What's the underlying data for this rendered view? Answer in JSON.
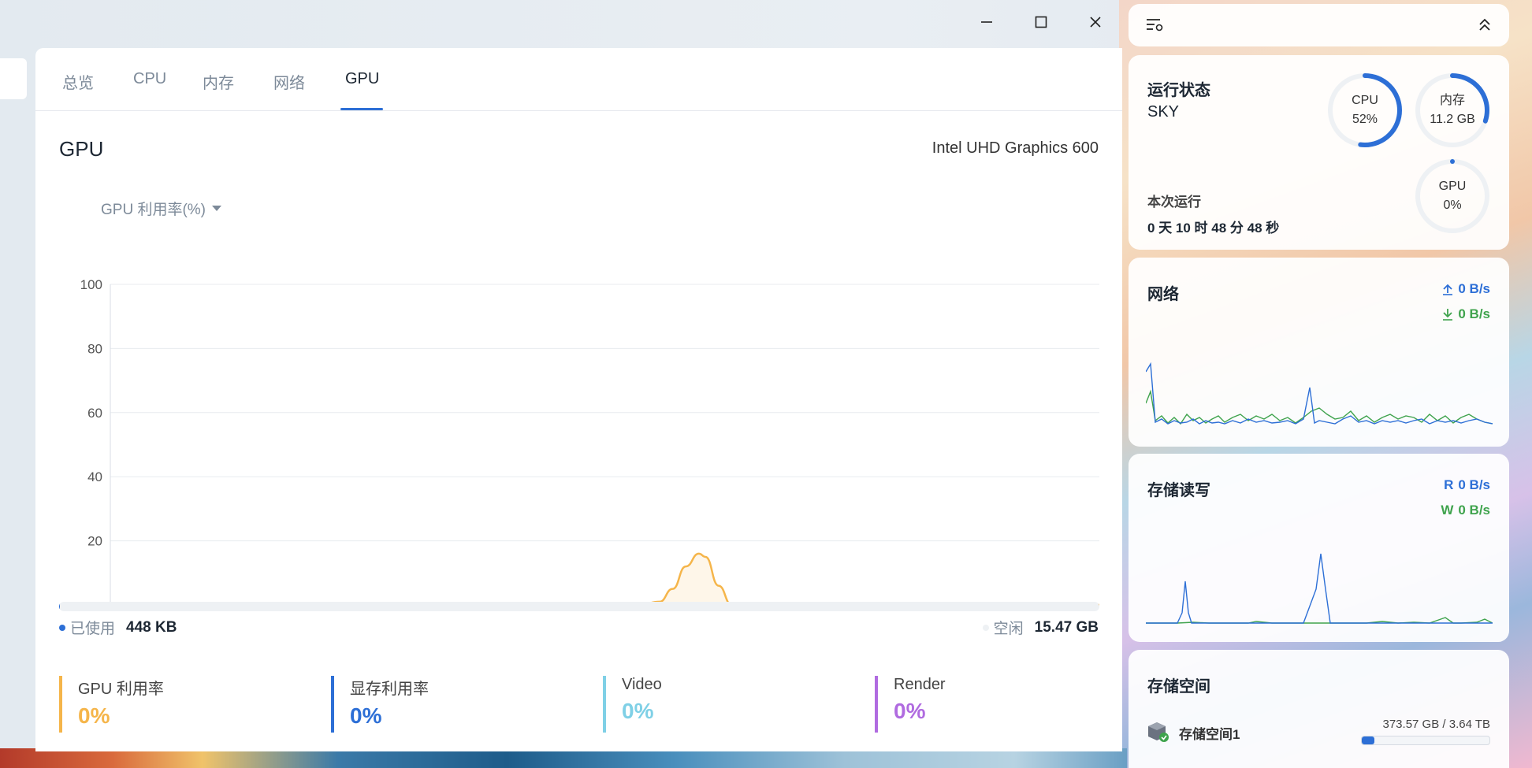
{
  "window": {
    "controls": [
      "minimize",
      "maximize",
      "close"
    ]
  },
  "tabs": [
    {
      "label": "总览",
      "active": false
    },
    {
      "label": "CPU",
      "active": false
    },
    {
      "label": "内存",
      "active": false
    },
    {
      "label": "网络",
      "active": false
    },
    {
      "label": "GPU",
      "active": true
    }
  ],
  "gpu": {
    "title": "GPU",
    "model": "Intel UHD Graphics 600",
    "metric_selector": "GPU 利用率(%)"
  },
  "chart_data": {
    "type": "area",
    "title": "",
    "xlabel": "",
    "ylabel": "",
    "ylim": [
      0,
      100
    ],
    "yticks": [
      "100",
      "80",
      "60",
      "40",
      "20"
    ],
    "grid": true,
    "series": [
      {
        "color": "#f5b54a",
        "x": [
          0,
          5,
          10,
          15,
          20,
          25,
          30,
          33,
          35,
          37,
          39,
          40,
          42,
          44,
          47,
          50,
          55,
          60,
          65,
          70,
          75,
          80,
          85,
          90,
          95,
          100
        ],
        "values": [
          0,
          0,
          0,
          0,
          0,
          0,
          0,
          1,
          5,
          12,
          16,
          15,
          6,
          0,
          0,
          0,
          0,
          0,
          0,
          0,
          0,
          0,
          0,
          0,
          0,
          0
        ]
      }
    ]
  },
  "memory": {
    "used_label": "已使用",
    "used_value": "448 KB",
    "free_label": "空闲",
    "free_value": "15.47 GB",
    "used_fraction": 0.0003
  },
  "stats": [
    {
      "label": "GPU 利用率",
      "value": "0%",
      "color": "#f5b54a"
    },
    {
      "label": "显存利用率",
      "value": "0%",
      "color": "#2d6fd6"
    },
    {
      "label": "Video",
      "value": "0%",
      "color": "#7fd0e6"
    },
    {
      "label": "Render",
      "value": "0%",
      "color": "#b06be0"
    }
  ],
  "status": {
    "title": "运行状态",
    "host": "SKY",
    "uptime_label": "本次运行",
    "uptime_value": "0 天 10 时 48 分 48 秒",
    "rings": [
      {
        "label": "CPU",
        "value": "52%",
        "fraction": 0.52,
        "color": "#2d6fd6"
      },
      {
        "label": "内存",
        "value": "11.2 GB",
        "fraction": 0.3,
        "color": "#2d6fd6"
      },
      {
        "label": "GPU",
        "value": "0%",
        "fraction": 0,
        "color": "#2d6fd6"
      }
    ]
  },
  "network": {
    "title": "网络",
    "upload": "0 B/s",
    "download": "0 B/s",
    "upload_color": "#2d6fd6",
    "download_color": "#3fa34d"
  },
  "disk_io": {
    "title": "存储读写",
    "read_prefix": "R",
    "read": "0 B/s",
    "write_prefix": "W",
    "write": "0 B/s"
  },
  "storage": {
    "title": "存储空间",
    "pool_name": "存储空间1",
    "used": "373.57 GB",
    "total": "3.64 TB",
    "separator": "/",
    "used_fraction": 0.1
  },
  "panel_toolbar": {
    "filter_icon": "list-settings-icon",
    "collapse_icon": "double-chevron-up-icon"
  }
}
